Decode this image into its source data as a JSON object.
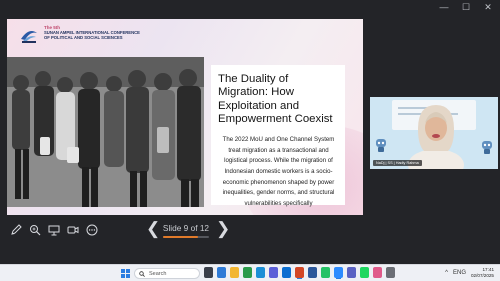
{
  "window": {
    "controls": {
      "minimize": "—",
      "maximize": "☐",
      "close": "✕"
    }
  },
  "slide": {
    "conference": {
      "edition": "The 5th",
      "name": "SUNAN AMPEL INTERNATIONAL CONFERENCE OF POLITICAL AND SOCIAL SCIENCES"
    },
    "title": "The Duality of Migration: How Exploitation and Empowerment Coexist",
    "body": "The 2022 MoU and One Channel System treat migration as a transactional and logistical process. While the migration of Indonesian domestic workers is a socio-economic phenomenon shaped by power inequalities, gender norms, and structural vulnerabilities specifically"
  },
  "presenter_toolbar": {
    "tools": [
      {
        "name": "pen-tool-icon"
      },
      {
        "name": "zoom-tool-icon"
      },
      {
        "name": "pointer-tool-icon"
      },
      {
        "name": "camera-tool-icon"
      },
      {
        "name": "more-options-icon"
      }
    ]
  },
  "slide_navigation": {
    "prev": "❮",
    "next": "❯",
    "counter": "Slide 9 of 12",
    "progress": 0.75
  },
  "video": {
    "participant_name": "NaDj | SS | Hadiy Rahma"
  },
  "taskbar": {
    "search_placeholder": "Search",
    "apps": [
      {
        "name": "task-view-icon",
        "color": "#3a3f4a"
      },
      {
        "name": "widgets-icon",
        "color": "#2f7bd6"
      },
      {
        "name": "file-explorer-icon",
        "color": "#f2b632"
      },
      {
        "name": "chrome-icon",
        "color": "#2a9a4a"
      },
      {
        "name": "edge-icon",
        "color": "#1c8fd6"
      },
      {
        "name": "store-icon",
        "color": "#5b5fd8"
      },
      {
        "name": "mail-icon",
        "color": "#0b6ed1"
      },
      {
        "name": "powerpoint-icon",
        "color": "#d24726",
        "active": true
      },
      {
        "name": "word-icon",
        "color": "#2b579a"
      },
      {
        "name": "whatsapp-icon",
        "color": "#25c266"
      },
      {
        "name": "zoom-icon",
        "color": "#2d8cff",
        "active": true
      },
      {
        "name": "teams-icon",
        "color": "#5a62c3"
      },
      {
        "name": "spotify-icon",
        "color": "#1ed760"
      },
      {
        "name": "photos-icon",
        "color": "#e05a8a"
      },
      {
        "name": "settings-icon",
        "color": "#6b6e75"
      }
    ],
    "tray": {
      "chevron": "^",
      "keyboard": "ENG",
      "clock_time": "17:41",
      "clock_date": "02/07/2025"
    }
  },
  "colors": {
    "accent": "#e07a2a",
    "slide_bg": "#f1e4ee",
    "app_bg": "#232428"
  }
}
